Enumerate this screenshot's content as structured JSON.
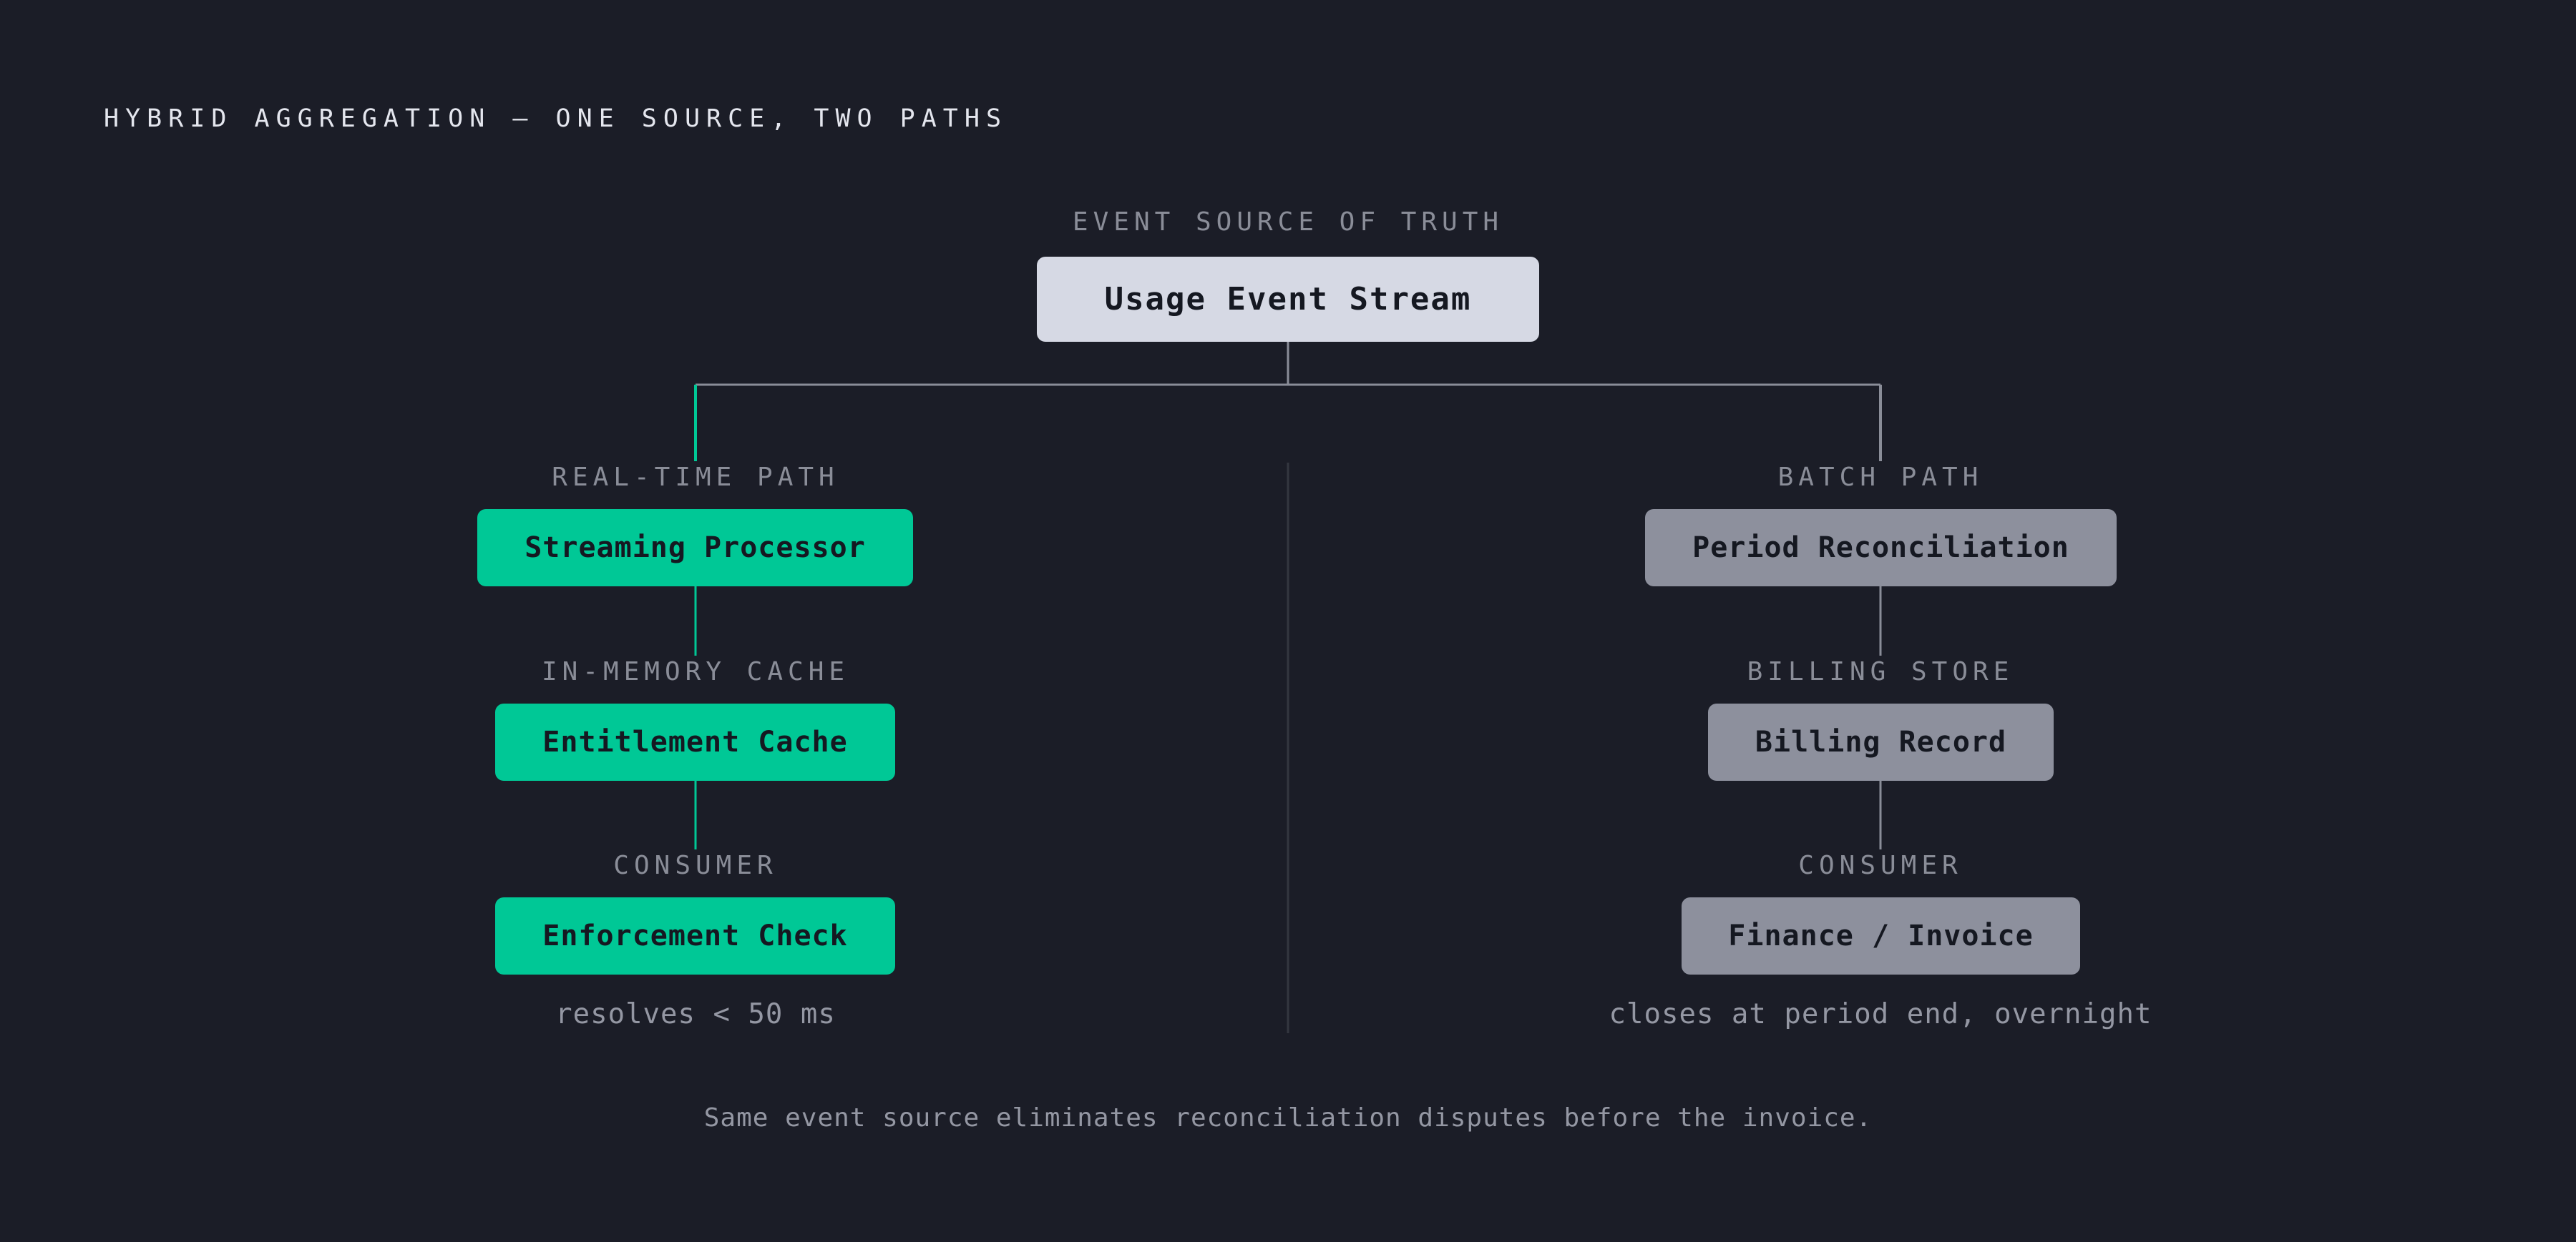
{
  "title": "HYBRID AGGREGATION — ONE SOURCE, TWO PATHS",
  "source": {
    "label": "EVENT SOURCE OF TRUTH",
    "box": "Usage Event Stream"
  },
  "realtime": {
    "path_label": "REAL-TIME PATH",
    "processor": "Streaming Processor",
    "cache_label": "IN-MEMORY CACHE",
    "cache": "Entitlement Cache",
    "consumer_label": "CONSUMER",
    "consumer": "Enforcement Check",
    "note": "resolves < 50 ms"
  },
  "batch": {
    "path_label": "BATCH PATH",
    "processor": "Period Reconciliation",
    "store_label": "BILLING STORE",
    "store": "Billing Record",
    "consumer_label": "CONSUMER",
    "consumer": "Finance / Invoice",
    "note": "closes at period end, overnight"
  },
  "footer": "Same event source eliminates reconciliation disputes before the invoice.",
  "colors": {
    "background": "#1b1d27",
    "realtime": "#00c896",
    "batch": "#8d909d",
    "source": "#d6d9e4",
    "connector": "#8a8d98"
  }
}
